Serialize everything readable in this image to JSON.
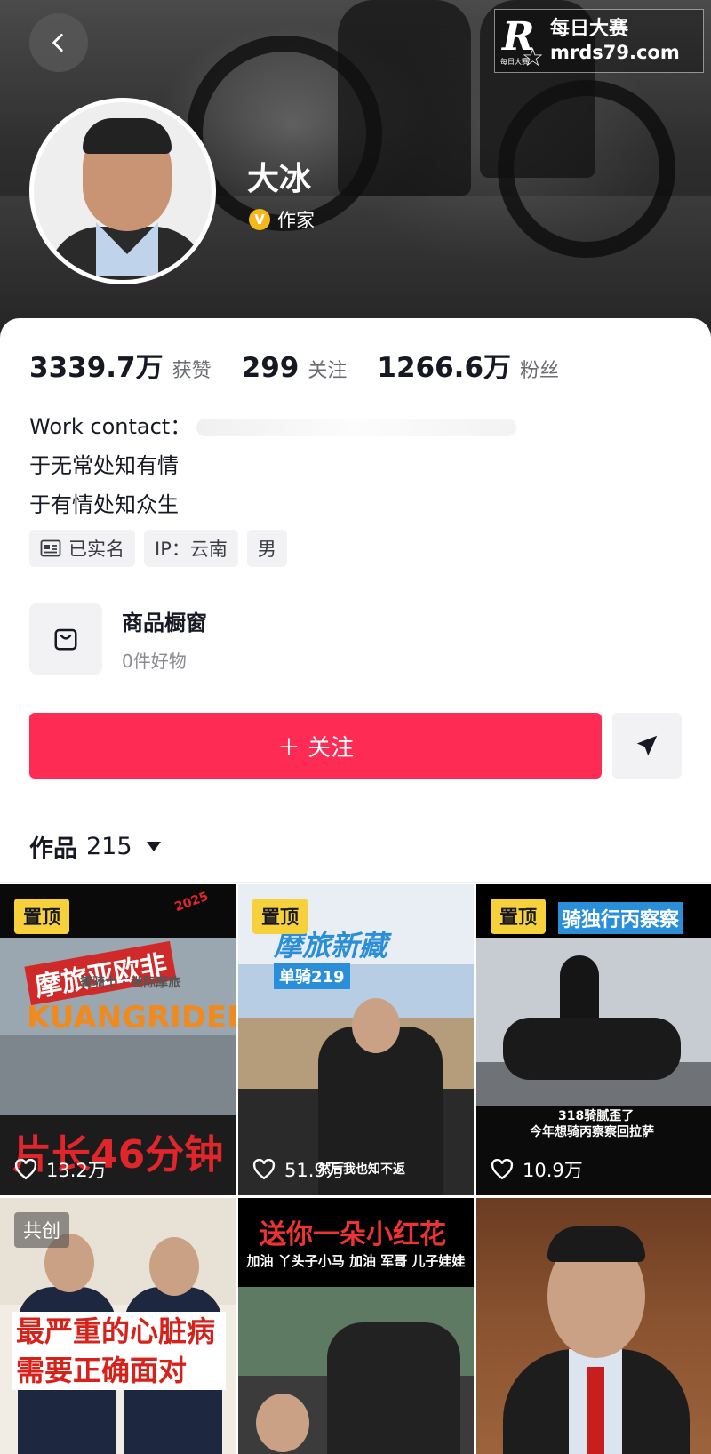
{
  "profile": {
    "nickname": "大冰",
    "verify_label": "作家",
    "verify_glyph": "V"
  },
  "watermark": {
    "logo_letter": "R",
    "logo_small": "每日大赛",
    "text_cn": "每日大赛",
    "url": "mrds79.com"
  },
  "stats": [
    {
      "value": "3339.7万",
      "label": "获赞"
    },
    {
      "value": "299",
      "label": "关注"
    },
    {
      "value": "1266.6万",
      "label": "粉丝"
    }
  ],
  "bio": {
    "line1": "Work contact：",
    "line2": "于无常处知有情",
    "line3": "于有情处知众生"
  },
  "tags": [
    {
      "icon": "id-card-icon",
      "label": "已实名"
    },
    {
      "label": "IP：云南"
    },
    {
      "label": "男"
    }
  ],
  "shop": {
    "title": "商品橱窗",
    "subtitle": "0件好物"
  },
  "actions": {
    "follow_label": "＋ 关注"
  },
  "works": {
    "label": "作品",
    "count": "215"
  },
  "videos": [
    {
      "badge": "置顶",
      "likes": "13.2万",
      "cover_top": "摩旅亚欧非",
      "cover_sub": "篝骑士 · 洲际摩旅",
      "cover_mid": "KUANGRIDER",
      "cover_bottom": "片长46分钟",
      "cover_year": "2025"
    },
    {
      "badge": "置顶",
      "likes": "51.9万",
      "cover_top": "摩旅新藏",
      "cover_badge": "单骑219",
      "cover_caption": "然后我也知不返"
    },
    {
      "badge": "置顶",
      "likes": "10.9万",
      "cover_top": "骑独行丙察察",
      "cover_caption1": "318骑腻歪了",
      "cover_caption2": "今年想骑丙察察回拉萨"
    },
    {
      "badge": "共创",
      "cover_text": "最严重的心脏病需要正确面对"
    },
    {
      "cover_top": "送你一朵小红花",
      "cover_sub": "加油  丫头子小马  加油  军哥  儿子娃娃"
    },
    {}
  ],
  "colors": {
    "accent": "#fe2c55",
    "pin_badge": "#f7d13c",
    "verify_badge": "#f5b719"
  }
}
